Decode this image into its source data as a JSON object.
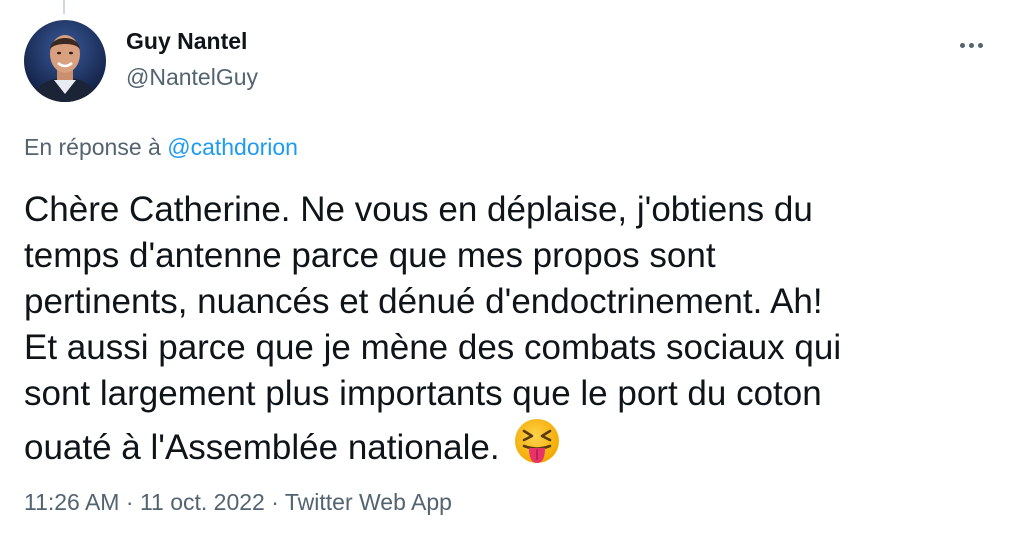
{
  "author": {
    "name": "Guy Nantel",
    "handle": "@NantelGuy",
    "avatar_icon": "profile-photo"
  },
  "more_icon": "more-horizontal-icon",
  "reply_context": {
    "prefix": "En réponse à ",
    "mention": "@cathdorion"
  },
  "tweet": {
    "text": "Chère Catherine. Ne vous en déplaise, j'obtiens du\ntemps d'antenne parce que mes propos sont\npertinents, nuancés et dénué d'endoctrinement. Ah!\nEt aussi parce que je mène des combats sociaux qui\nsont largement plus importants que le port du coton\nouaté à l'Assemblée nationale.",
    "emoji_icon": "squinting-face-with-tongue-icon"
  },
  "meta": {
    "time": "11:26 AM",
    "separator1": " · ",
    "date": "11 oct. 2022",
    "separator2": " · ",
    "source": "Twitter Web App"
  },
  "colors": {
    "text": "#0f1419",
    "secondary": "#536471",
    "link": "#1d9bf0",
    "background": "#ffffff"
  }
}
